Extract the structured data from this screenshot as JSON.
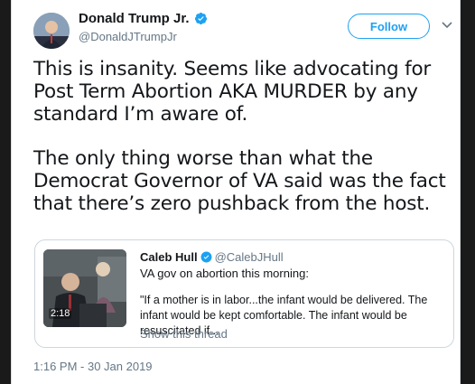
{
  "author": {
    "name": "Donald Trump Jr.",
    "handle": "@DonaldJTrumpJr",
    "avatar_icon": "avatar-photo",
    "verified_icon": "verified-badge-icon"
  },
  "actions": {
    "follow_label": "Follow",
    "menu_icon": "chevron-down-icon"
  },
  "tweet": {
    "paragraph1": "This is insanity. Seems like advocating for Post Term Abortion AKA MURDER by any standard I’m aware of.",
    "paragraph2": "The only thing worse than what the Democrat Governor of VA said was the fact that there’s zero pushback from the host."
  },
  "quoted_tweet": {
    "author_name": "Caleb Hull",
    "author_handle": "@CalebJHull",
    "line1": "VA gov on abortion this morning:",
    "line2": "\"If a mother is in labor...the infant would be delivered. The infant would be kept comfortable. The infant would be resuscitated if...",
    "show_thread": "Show this thread",
    "video_duration": "2:18"
  },
  "timestamp": "1:16 PM - 30 Jan 2019",
  "colors": {
    "accent": "#1da1f2",
    "text": "#14171a",
    "muted": "#657786",
    "border": "#ccd6dd"
  }
}
